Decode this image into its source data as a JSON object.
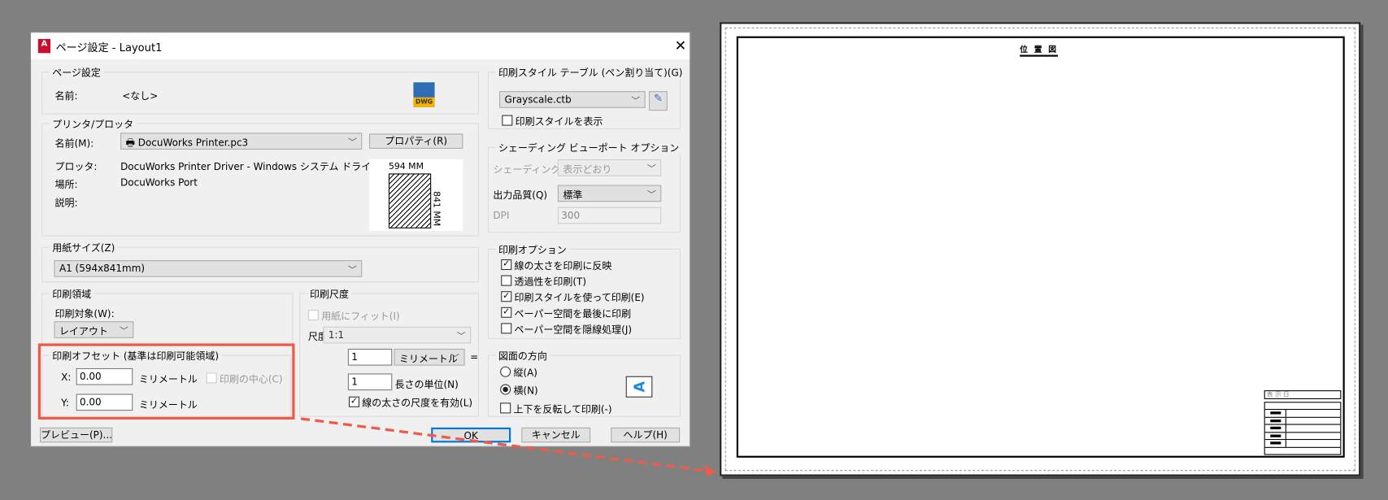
{
  "dialog": {
    "title": "ページ設定 - Layout1",
    "app_icon_letter": "A",
    "page_setup": {
      "label": "ページ設定",
      "name_label": "名前:",
      "name_value": "<なし>",
      "dwg_label": "DWG"
    },
    "printer": {
      "label": "プリンタ/プロッタ",
      "name_label": "名前(M):",
      "name_value": "DocuWorks Printer.pc3",
      "properties_button": "プロパティ(R)",
      "plotter_label": "プロッタ:",
      "plotter_value": "DocuWorks Printer Driver - Windows システム ドライバ - b...",
      "location_label": "場所:",
      "location_value": "DocuWorks Port",
      "description_label": "説明:",
      "preview_width": "594 MM",
      "preview_height": "841 MM"
    },
    "paper_size": {
      "label": "用紙サイズ(Z)",
      "value": "A1 (594x841mm)"
    },
    "plot_area": {
      "label": "印刷領域",
      "what_label": "印刷対象(W):",
      "what_value": "レイアウト"
    },
    "plot_offset": {
      "label": "印刷オフセット (基準は印刷可能領域)",
      "x_label": "X:",
      "x_value": "0.00",
      "y_label": "Y:",
      "y_value": "0.00",
      "unit": "ミリメートル",
      "center_label": "印刷の中心(C)"
    },
    "plot_scale": {
      "label": "印刷尺度",
      "fit_label": "用紙にフィット(I)",
      "scale_label": "尺度(S):",
      "scale_value": "1:1",
      "value1": "1",
      "unit_value": "ミリメートル",
      "equals": "=",
      "value2": "1",
      "units_label": "長さの単位(N)",
      "lineweights_label": "線の太さの尺度を有効(L)"
    },
    "style_table": {
      "label": "印刷スタイル テーブル (ペン割り当て)(G)",
      "value": "Grayscale.ctb",
      "display_label": "印刷スタイルを表示"
    },
    "shading": {
      "label": "シェーディング ビューポート オプション",
      "shade_label": "シェーディング(D)",
      "shade_value": "表示どおり",
      "quality_label": "出力品質(Q)",
      "quality_value": "標準",
      "dpi_label": "DPI",
      "dpi_value": "300"
    },
    "plot_options": {
      "label": "印刷オプション",
      "items": [
        {
          "label": "線の太さを印刷に反映",
          "checked": true
        },
        {
          "label": "透過性を印刷(T)",
          "checked": false
        },
        {
          "label": "印刷スタイルを使って印刷(E)",
          "checked": true
        },
        {
          "label": "ペーパー空間を最後に印刷",
          "checked": true
        },
        {
          "label": "ペーパー空間を隠線処理(J)",
          "checked": false
        }
      ]
    },
    "orientation": {
      "label": "図面の方向",
      "portrait": "縦(A)",
      "landscape": "横(N)",
      "upside_down": "上下を反転して印刷(-)",
      "selected": "landscape"
    },
    "buttons": {
      "preview": "プレビュー(P)...",
      "ok": "OK",
      "cancel": "キャンセル",
      "help": "ヘルプ(H)"
    }
  },
  "drawing": {
    "title": "位 置 図",
    "title_block_header": "表 示 日"
  },
  "colors": {
    "highlight": "#f05a4a",
    "accent": "#0078d7"
  }
}
